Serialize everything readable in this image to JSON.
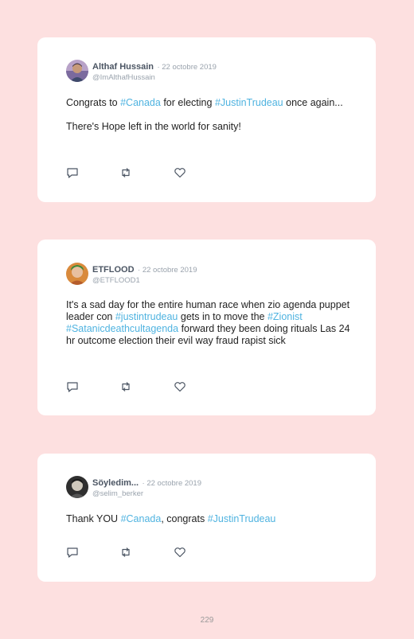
{
  "tweets": [
    {
      "name": "Althaf Hussain",
      "date": "· 22 octobre 2019",
      "handle": "@ImAlthafHussain",
      "avatar_icon": "person-avatar",
      "lines": [
        [
          {
            "t": "Congrats to ",
            "tag": false
          },
          {
            "t": "#Canada",
            "tag": true
          },
          {
            "t": " for electing ",
            "tag": false
          },
          {
            "t": "#JustinTrudeau",
            "tag": true
          },
          {
            "t": " once again...",
            "tag": false
          }
        ],
        [
          {
            "t": "There's Hope left in the world for sanity!",
            "tag": false
          }
        ]
      ]
    },
    {
      "name": "ETFLOOD",
      "date": "· 22 octobre 2019",
      "handle": "@ETFLOOD1",
      "avatar_icon": "person-avatar",
      "lines": [
        [
          {
            "t": "It's a sad day for the entire human race when zio agenda puppet leader con ",
            "tag": false
          },
          {
            "t": "#justintrudeau",
            "tag": true
          },
          {
            "t": " gets in to move the ",
            "tag": false
          },
          {
            "t": "#Zionist",
            "tag": true
          },
          {
            "t": " ",
            "tag": false
          },
          {
            "t": "#Satanicdeathcultagenda",
            "tag": true
          },
          {
            "t": " forward they been doing rituals Las 24 hr outcome election their evil way fraud rapist sick",
            "tag": false
          }
        ]
      ]
    },
    {
      "name": "Söyledim...",
      "date": "· 22 octobre 2019",
      "handle": "@selim_berker",
      "avatar_icon": "person-avatar",
      "lines": [
        [
          {
            "t": "Thank YOU ",
            "tag": false
          },
          {
            "t": "#Canada",
            "tag": true
          },
          {
            "t": ", congrats ",
            "tag": false
          },
          {
            "t": "#JustinTrudeau",
            "tag": true
          }
        ]
      ]
    }
  ],
  "actions": [
    "reply-icon",
    "retweet-icon",
    "like-icon"
  ],
  "colors": {
    "page_bg": "#fde0e0",
    "card_bg": "#ffffff",
    "hashtag": "#4fb3e0",
    "name": "#4b5563",
    "muted": "#9aa3ad"
  },
  "page_number": "229"
}
